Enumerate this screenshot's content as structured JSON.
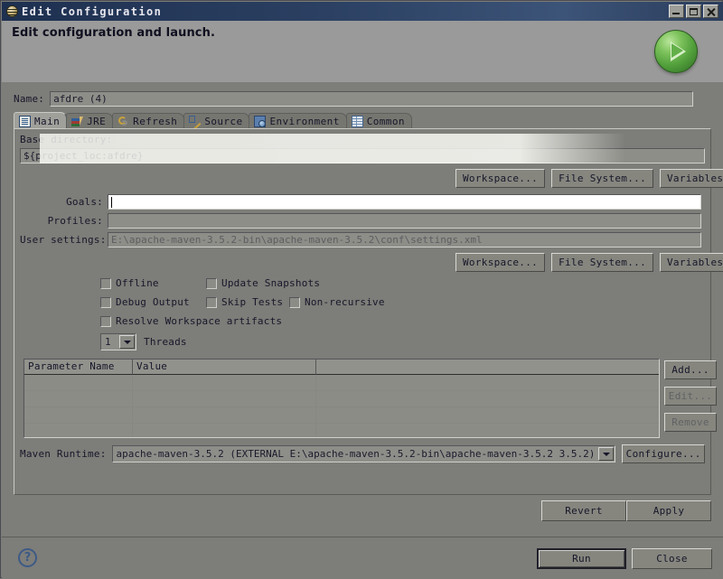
{
  "window": {
    "title": "Edit Configuration",
    "icon": "maven-globe-icon",
    "controls": {
      "minimize": "minimize",
      "maximize": "maximize",
      "close": "close"
    }
  },
  "header": {
    "title": "Edit configuration and launch.",
    "run_badge": "run-play-icon"
  },
  "name": {
    "label": "Name:",
    "value": "afdre (4)"
  },
  "tabs": [
    {
      "label": "Main",
      "icon": "document-icon",
      "active": true
    },
    {
      "label": "JRE",
      "icon": "books-icon",
      "active": false
    },
    {
      "label": "Refresh",
      "icon": "refresh-icon",
      "active": false
    },
    {
      "label": "Source",
      "icon": "pencil-icon",
      "active": false
    },
    {
      "label": "Environment",
      "icon": "environment-icon",
      "active": false
    },
    {
      "label": "Common",
      "icon": "grid-icon",
      "active": false
    }
  ],
  "main": {
    "base_directory": {
      "label": "Base directory:",
      "value": "${project_loc:afdre}"
    },
    "dir_buttons": [
      {
        "label": "Workspace..."
      },
      {
        "label": "File System..."
      },
      {
        "label": "Variables..."
      }
    ],
    "goals": {
      "label": "Goals:",
      "value": "",
      "focused": true
    },
    "profiles": {
      "label": "Profiles:",
      "value": ""
    },
    "user_settings": {
      "label": "User settings:",
      "value": "E:\\apache-maven-3.5.2-bin\\apache-maven-3.5.2\\conf\\settings.xml"
    },
    "settings_buttons": [
      {
        "label": "Workspace..."
      },
      {
        "label": "File System..."
      },
      {
        "label": "Variables..."
      }
    ],
    "checkboxes": [
      {
        "label": "Offline",
        "checked": false
      },
      {
        "label": "Update Snapshots",
        "checked": false
      },
      {
        "label": "Debug Output",
        "checked": false
      },
      {
        "label": "Skip Tests",
        "checked": false
      },
      {
        "label": "Non-recursive",
        "checked": false
      },
      {
        "label": "Resolve Workspace artifacts",
        "checked": false
      }
    ],
    "threads": {
      "value": "1",
      "label": "Threads"
    },
    "parameters_table": {
      "columns": [
        "Parameter Name",
        "Value",
        ""
      ],
      "rows": [],
      "empty_row_count": 5
    },
    "table_buttons": [
      {
        "label": "Add...",
        "enabled": true
      },
      {
        "label": "Edit...",
        "enabled": false
      },
      {
        "label": "Remove",
        "enabled": false
      }
    ],
    "maven_runtime": {
      "label": "Maven Runtime:",
      "value": "apache-maven-3.5.2  (EXTERNAL E:\\apache-maven-3.5.2-bin\\apache-maven-3.5.2 3.5.2)",
      "configure_label": "Configure..."
    },
    "revert_label": "Revert",
    "apply_label": "Apply"
  },
  "footer": {
    "help": "?",
    "run_label": "Run",
    "close_label": "Close"
  },
  "colors": {
    "background": "#7d7d79",
    "header": "#9a9a9a",
    "titlebar": "#2b4062",
    "accent_green": "#52a03c",
    "text": "#17172a"
  }
}
